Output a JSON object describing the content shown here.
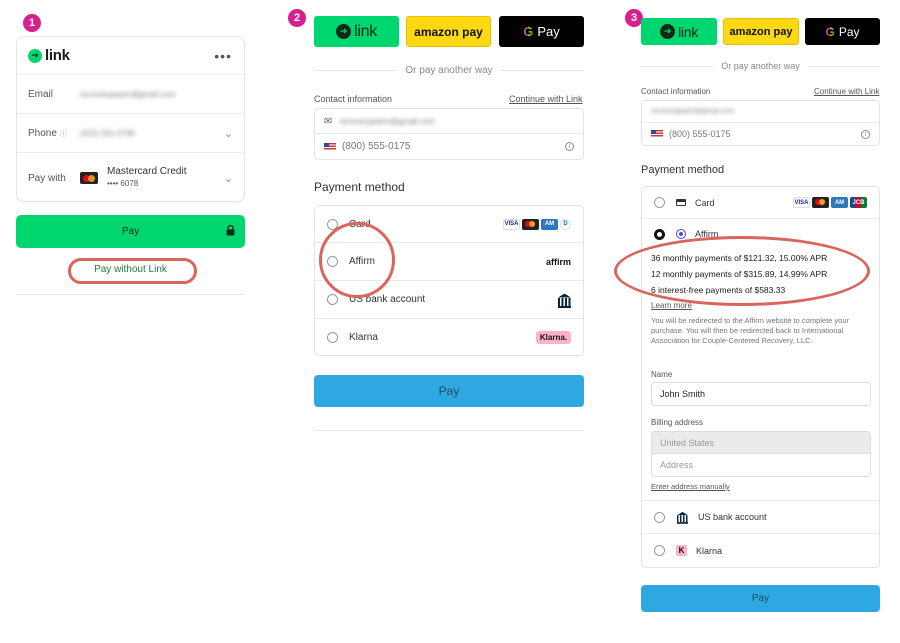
{
  "steps": [
    "1",
    "2",
    "3"
  ],
  "panel1": {
    "logo_text": "link",
    "menu": "•••",
    "email_label": "Email",
    "email_value": "recoverypaem@gmail.com",
    "phone_label": "Phone",
    "phone_value": "(415) 341-2706",
    "paywith_label": "Pay with",
    "card_name": "Mastercard Credit",
    "card_last4": "•••• 6078",
    "pay_label": "Pay",
    "pay_without_link": "Pay without Link"
  },
  "panel2": {
    "wallets": {
      "link": "link",
      "amazon": "amazon pay",
      "gpay_g": "G",
      "gpay": "Pay"
    },
    "or_text": "Or pay another way",
    "contact_label": "Contact information",
    "continue_link": "Continue with Link",
    "email_value": "recoverypaem@gmail.com",
    "phone_value": "(800) 555-0175",
    "payment_title": "Payment method",
    "methods": [
      "Card",
      "Affirm",
      "US bank account",
      "Klarna"
    ],
    "affirm_logo": "affirm",
    "klarna_logo": "Klarna.",
    "pay_label": "Pay"
  },
  "panel3": {
    "wallets": {
      "link": "link",
      "amazon": "amazon pay",
      "gpay_g": "G",
      "gpay": "Pay"
    },
    "or_text": "Or pay another way",
    "contact_label": "Contact information",
    "continue_link": "Continue with Link",
    "email_value": "recoverypaem@gmail.com",
    "phone_value": "(800) 555-0175",
    "payment_title": "Payment method",
    "card_label": "Card",
    "affirm_label": "Affirm",
    "plans": [
      "36 monthly payments of $121.32, 15.00% APR",
      "12 monthly payments of $315.89, 14.99% APR",
      "6 interest-free payments of $583.33"
    ],
    "learn_more": "Learn more",
    "redirect_text": "You will be redirected to the Affirm website to complete your purchase. You will then be redirected back to International Association for Couple-Centered Recovery, LLC.",
    "name_label": "Name",
    "name_value": "John Smith",
    "billing_label": "Billing address",
    "country_value": "United States",
    "address_placeholder": "Address",
    "manual_link": "Enter address manually",
    "bank_label": "US bank account",
    "klarna_label": "Klarna",
    "pay_label": "Pay"
  },
  "colors": {
    "link_green": "#00d66f",
    "amazon_yellow": "#ffd814",
    "pay_blue": "#2fa7e0",
    "badge_pink": "#d6208f",
    "annotation_red": "#d9655c"
  }
}
